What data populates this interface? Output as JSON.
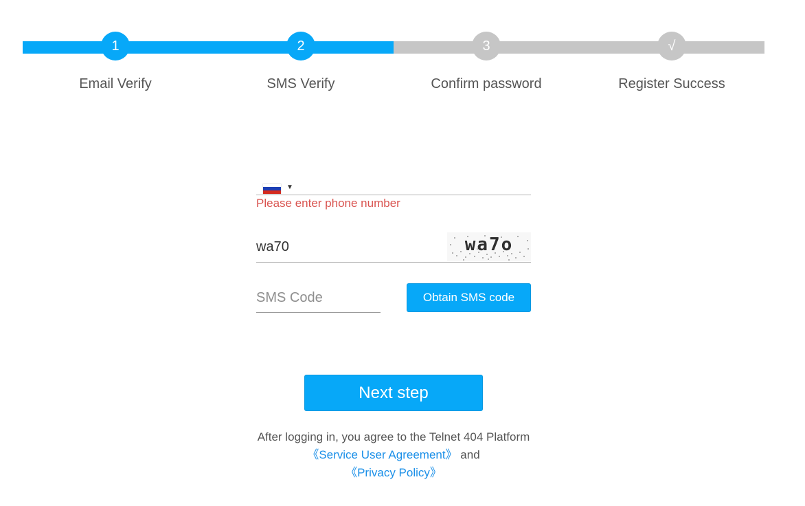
{
  "stepper": {
    "active_color": "#07a8f8",
    "inactive_color": "#c6c6c6",
    "steps": [
      {
        "number": "1",
        "label": "Email Verify",
        "state": "done"
      },
      {
        "number": "2",
        "label": "SMS Verify",
        "state": "done"
      },
      {
        "number": "3",
        "label": "Confirm password",
        "state": "todo"
      },
      {
        "number": "√",
        "label": "Register Success",
        "state": "todo"
      }
    ]
  },
  "form": {
    "phone": {
      "country_flag": "russia-flag-icon",
      "dropdown_icon": "triangle-down-icon",
      "value": "",
      "error": "Please enter phone number"
    },
    "captcha": {
      "value": "wa70",
      "image_text": "wa7o"
    },
    "sms": {
      "placeholder": "SMS Code",
      "value": "",
      "button_label": "Obtain SMS code"
    },
    "next_label": "Next step",
    "error_color": "#d9534f",
    "link_color": "#1a8fe8"
  },
  "agreement": {
    "prefix": "After logging in, you agree to the Telnet 404 Platform ",
    "service_link": "《Service User Agreement》",
    "middle": " and ",
    "privacy_link": "《Privacy Policy》"
  }
}
